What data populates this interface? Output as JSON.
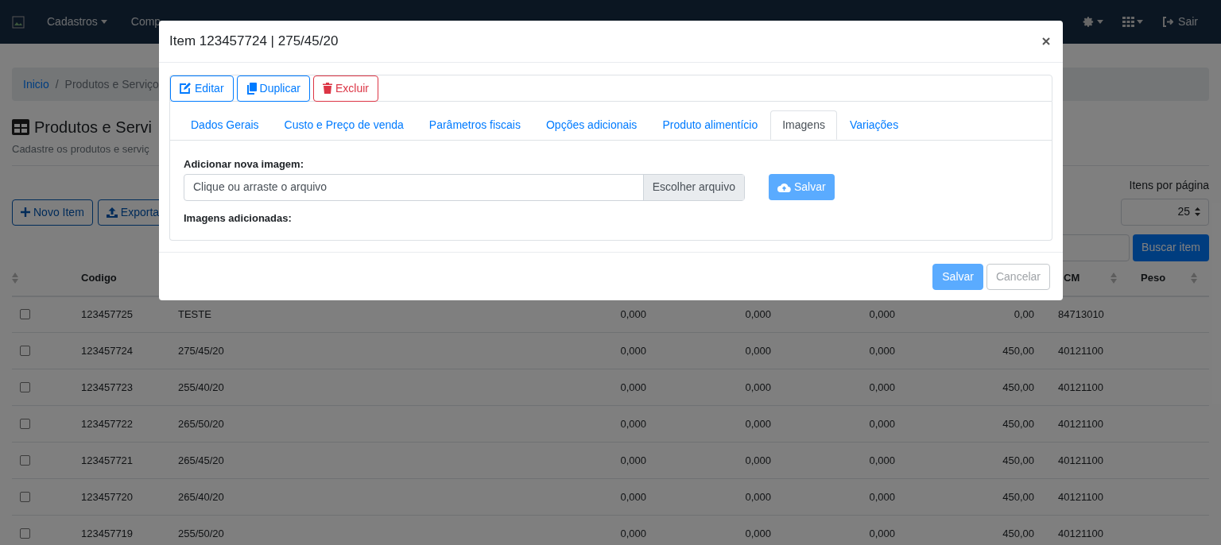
{
  "navbar": {
    "menus": [
      {
        "label": "Cadastros"
      },
      {
        "label": "Comp"
      }
    ],
    "exit": {
      "label": "Sair"
    }
  },
  "breadcrumb": {
    "separator": "/",
    "items": [
      {
        "label": "Inicio",
        "kind": "link"
      },
      {
        "label": "Produtos e Serviço",
        "kind": "current"
      }
    ]
  },
  "page": {
    "title": "Produtos e Servi",
    "subtitle": "Cadastre os produtos e serviç"
  },
  "toolbar": [
    {
      "label": "Novo Item",
      "kind": "plus"
    },
    {
      "label": "Exporta",
      "kind": "export"
    }
  ],
  "per_page": {
    "label": "Itens por página",
    "value": "25"
  },
  "search": {
    "button": "Buscar item"
  },
  "table": {
    "columns": [
      {
        "label": "Codigo",
        "kind": "sortable"
      },
      {
        "kind": "hidden"
      },
      {
        "kind": "hidden"
      },
      {
        "kind": "hidden"
      },
      {
        "kind": "hidden"
      },
      {
        "kind": "hidden"
      },
      {
        "label": "CM",
        "kind": "sortable"
      },
      {
        "label": "Peso",
        "kind": "sortable"
      }
    ],
    "rows": [
      {
        "checked": false,
        "cells": [
          "123457725",
          "TESTE",
          "0,000",
          "0,000",
          "0,000",
          "0,00",
          "84713010"
        ]
      },
      {
        "checked": false,
        "cells": [
          "123457724",
          "275/45/20",
          "0,000",
          "0,000",
          "0,000",
          "450,00",
          "40121100"
        ]
      },
      {
        "checked": false,
        "cells": [
          "123457723",
          "255/40/20",
          "0,000",
          "0,000",
          "0,000",
          "450,00",
          "40121100"
        ]
      },
      {
        "checked": false,
        "cells": [
          "123457722",
          "265/50/20",
          "0,000",
          "0,000",
          "0,000",
          "450,00",
          "40121100"
        ]
      },
      {
        "checked": false,
        "cells": [
          "123457721",
          "265/45/20",
          "0,000",
          "0,000",
          "0,000",
          "450,00",
          "40121100"
        ]
      },
      {
        "checked": false,
        "cells": [
          "123457720",
          "265/40/20",
          "0,000",
          "0,000",
          "0,000",
          "450,00",
          "40121100"
        ]
      },
      {
        "checked": false,
        "cells": [
          "123457719",
          "255/50/20",
          "0,000",
          "0,000",
          "0,000",
          "450,00",
          "40121100"
        ]
      }
    ]
  },
  "modal": {
    "title": "Item 123457724 | 275/45/20",
    "actions": [
      {
        "label": "Editar",
        "kind": "edit"
      },
      {
        "label": "Duplicar",
        "kind": "copy"
      },
      {
        "label": "Excluir",
        "kind": "delete"
      }
    ],
    "tabs": [
      {
        "label": "Dados Gerais",
        "selected": false
      },
      {
        "label": "Custo e Preço de venda",
        "selected": false
      },
      {
        "label": "Parâmetros fiscais",
        "selected": false
      },
      {
        "label": "Opções adicionais",
        "selected": false
      },
      {
        "label": "Produto alimentício",
        "selected": false
      },
      {
        "label": "Imagens",
        "selected": true
      },
      {
        "label": "Variações",
        "selected": false
      }
    ],
    "upload": {
      "label": "Adicionar nova imagem:",
      "placeholder": "Clique ou arraste o arquivo",
      "browse": "Escolher arquivo",
      "save": {
        "label": "Salvar",
        "disabled": true
      }
    },
    "added_label": "Imagens adicionadas:",
    "footer_buttons": [
      {
        "label": "Salvar",
        "kind": "primary",
        "disabled": true
      },
      {
        "label": "Cancelar",
        "kind": "secondary",
        "disabled": true
      }
    ]
  }
}
